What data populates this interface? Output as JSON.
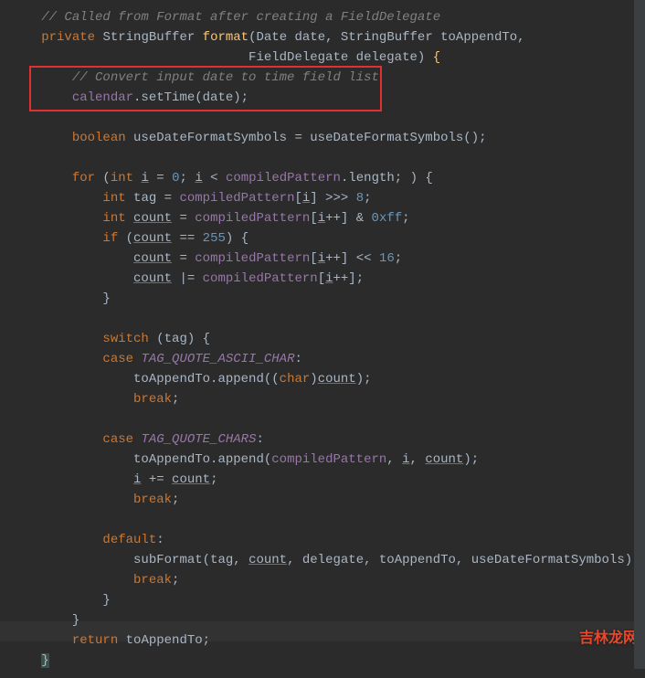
{
  "code": {
    "l1": "// Called from Format after creating a FieldDelegate",
    "l2_private": "private",
    "l2_type1": "StringBuffer",
    "l2_method": "format",
    "l2_params": "(Date date, StringBuffer toAppendTo,",
    "l3_params": "FieldDelegate delegate)",
    "l4": "// Convert input date to time field list",
    "l5_calendar": "calendar",
    "l5_settime": ".setTime(date);",
    "l6_boolean": "boolean",
    "l6_var": "useDateFormatSymbols = ",
    "l6_call": "useDateFormatSymbols",
    "l6_end": "();",
    "l7_for": "for",
    "l7_int": "int",
    "l7_i": "i",
    "l7_eq": " = ",
    "l7_zero": "0",
    "l7_semi": "; ",
    "l7_i2": "i",
    "l7_lt": " < ",
    "l7_cp": "compiledPattern",
    "l7_len": ".length; ) {",
    "l8_int": "int",
    "l8_var": " tag = ",
    "l8_cp": "compiledPattern",
    "l8_br": "[",
    "l8_i": "i",
    "l8_end": "] >>> ",
    "l8_num": "8",
    "l8_semi": ";",
    "l9_int": "int",
    "l9_count": "count",
    "l9_eq": " = ",
    "l9_cp": "compiledPattern",
    "l9_br": "[",
    "l9_i": "i",
    "l9_end": "++] & ",
    "l9_hex": "0xff",
    "l9_semi": ";",
    "l10_if": "if",
    "l10_open": " (",
    "l10_count": "count",
    "l10_eq": " == ",
    "l10_num": "255",
    "l10_close": ") {",
    "l11_count": "count",
    "l11_eq": " = ",
    "l11_cp": "compiledPattern",
    "l11_br": "[",
    "l11_i": "i",
    "l11_end": "++] << ",
    "l11_num": "16",
    "l11_semi": ";",
    "l12_count": "count",
    "l12_eq": " |= ",
    "l12_cp": "compiledPattern",
    "l12_br": "[",
    "l12_i": "i",
    "l12_end": "++];",
    "l13": "}",
    "l14_switch": "switch",
    "l14_rest": " (tag) {",
    "l15_case": "case",
    "l15_const": "TAG_QUOTE_ASCII_CHAR",
    "l15_colon": ":",
    "l16_call": "toAppendTo.append((",
    "l16_char": "char",
    "l16_close": ")",
    "l16_count": "count",
    "l16_end": ");",
    "l17_break": "break",
    "l17_semi": ";",
    "l18_case": "case",
    "l18_const": "TAG_QUOTE_CHARS",
    "l18_colon": ":",
    "l19_call": "toAppendTo.append(",
    "l19_cp": "compiledPattern",
    "l19_comma": ", ",
    "l19_i": "i",
    "l19_comma2": ", ",
    "l19_count": "count",
    "l19_end": ");",
    "l20_i": "i",
    "l20_eq": " += ",
    "l20_count": "count",
    "l20_semi": ";",
    "l21_break": "break",
    "l21_semi": ";",
    "l22_default": "default",
    "l22_colon": ":",
    "l23_call": "subFormat(tag, ",
    "l23_count": "count",
    "l23_rest": ", delegate, toAppendTo, useDateFormatSymbols);",
    "l24_break": "break",
    "l24_semi": ";",
    "l25": "}",
    "l26": "}",
    "l27_return": "return",
    "l27_var": " toAppendTo;",
    "l28": "}"
  },
  "watermark": "吉林龙网"
}
